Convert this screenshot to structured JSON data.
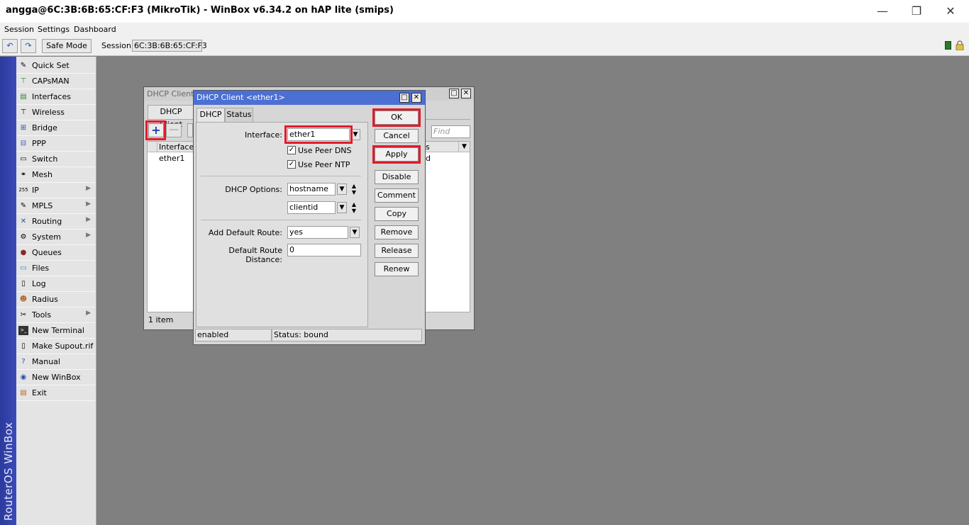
{
  "window": {
    "title": "angga@6C:3B:6B:65:CF:F3 (MikroTik) - WinBox v6.34.2 on hAP lite (smips)",
    "minimize": "—",
    "maximize": "❐",
    "close": "✕"
  },
  "menubar": {
    "items": [
      "Session",
      "Settings",
      "Dashboard"
    ]
  },
  "toolbar": {
    "undo_icon": "↶",
    "redo_icon": "↷",
    "safe_mode": "Safe Mode",
    "session_label": "Session:",
    "session_value": "6C:3B:6B:65:CF:F3"
  },
  "brand": "RouterOS WinBox",
  "sidebar": {
    "items": [
      {
        "label": "Quick Set",
        "icon": "quickset-icon",
        "submenu": false
      },
      {
        "label": "CAPsMAN",
        "icon": "capsman-icon",
        "submenu": false
      },
      {
        "label": "Interfaces",
        "icon": "interfaces-icon",
        "submenu": false
      },
      {
        "label": "Wireless",
        "icon": "wireless-icon",
        "submenu": false
      },
      {
        "label": "Bridge",
        "icon": "bridge-icon",
        "submenu": false
      },
      {
        "label": "PPP",
        "icon": "ppp-icon",
        "submenu": false
      },
      {
        "label": "Switch",
        "icon": "switch-icon",
        "submenu": false
      },
      {
        "label": "Mesh",
        "icon": "mesh-icon",
        "submenu": false
      },
      {
        "label": "IP",
        "icon": "ip-icon",
        "submenu": true
      },
      {
        "label": "MPLS",
        "icon": "mpls-icon",
        "submenu": true
      },
      {
        "label": "Routing",
        "icon": "routing-icon",
        "submenu": true
      },
      {
        "label": "System",
        "icon": "system-icon",
        "submenu": true
      },
      {
        "label": "Queues",
        "icon": "queues-icon",
        "submenu": false
      },
      {
        "label": "Files",
        "icon": "files-icon",
        "submenu": false
      },
      {
        "label": "Log",
        "icon": "log-icon",
        "submenu": false
      },
      {
        "label": "Radius",
        "icon": "radius-icon",
        "submenu": false
      },
      {
        "label": "Tools",
        "icon": "tools-icon",
        "submenu": true
      },
      {
        "label": "New Terminal",
        "icon": "terminal-icon",
        "submenu": false
      },
      {
        "label": "Make Supout.rif",
        "icon": "supout-icon",
        "submenu": false
      },
      {
        "label": "Manual",
        "icon": "manual-icon",
        "submenu": false
      },
      {
        "label": "New WinBox",
        "icon": "winbox-icon",
        "submenu": false
      },
      {
        "label": "Exit",
        "icon": "exit-icon",
        "submenu": false
      }
    ]
  },
  "list_window": {
    "title": "DHCP Client",
    "tab": "DHCP Client",
    "find_placeholder": "Find",
    "columns": [
      "Interface",
      "s"
    ],
    "rows": [
      {
        "interface": "ether1",
        "status": "d"
      }
    ],
    "footer": "1 item"
  },
  "edit_window": {
    "title": "DHCP Client <ether1>",
    "tabs": [
      "DHCP",
      "Status"
    ],
    "interface_label": "Interface:",
    "interface_value": "ether1",
    "use_peer_dns": "Use Peer DNS",
    "use_peer_ntp": "Use Peer NTP",
    "dhcp_options_label": "DHCP Options:",
    "dhcp_option_1": "hostname",
    "dhcp_option_2": "clientid",
    "add_default_route_label": "Add Default Route:",
    "add_default_route_value": "yes",
    "default_route_distance_label": "Default Route Distance:",
    "default_route_distance_value": "0",
    "buttons": {
      "ok": "OK",
      "cancel": "Cancel",
      "apply": "Apply",
      "disable": "Disable",
      "comment": "Comment",
      "copy": "Copy",
      "remove": "Remove",
      "release": "Release",
      "renew": "Renew"
    },
    "status_left": "enabled",
    "status_right": "Status: bound"
  },
  "colors": {
    "highlight": "#e21b2a",
    "brand_strip": "#2a3a9c",
    "title_active": "#4b6fd3"
  }
}
